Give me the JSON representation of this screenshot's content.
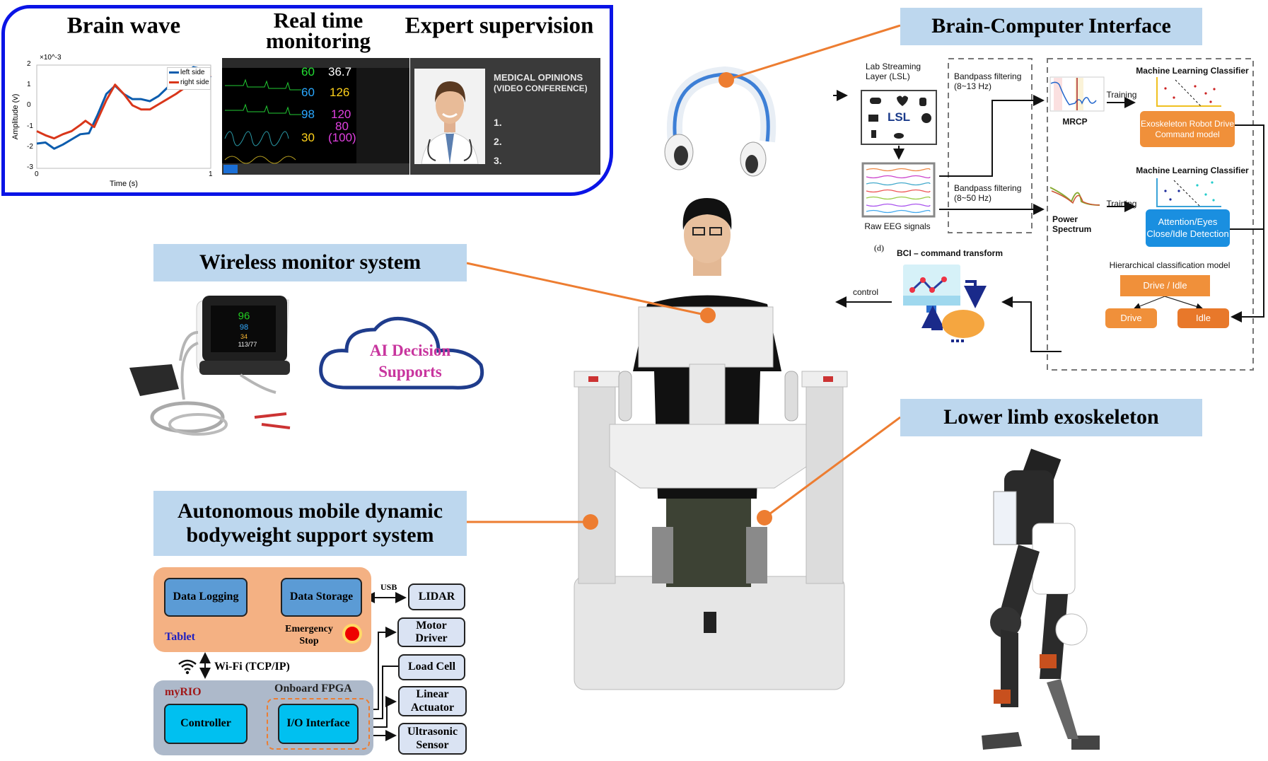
{
  "top_panel": {
    "brain_wave_title": "Brain wave",
    "monitoring_title": "Real time monitoring",
    "expert_title": "Expert supervision",
    "frame_color": "#0a14e6"
  },
  "chart_data": {
    "type": "line",
    "xlabel": "Time (s)",
    "ylabel": "Amplitude (v)",
    "y_multiplier": "×10^-3",
    "xlim": [
      0,
      1
    ],
    "ylim": [
      -3,
      2
    ],
    "x_ticks": [
      "0",
      "1"
    ],
    "y_ticks": [
      "2",
      "1",
      "0",
      "-1",
      "-2",
      "-3"
    ],
    "legend_placement": "top-right",
    "series": [
      {
        "name": "left side",
        "color": "#0b5cad",
        "x": [
          0,
          0.05,
          0.1,
          0.15,
          0.2,
          0.25,
          0.3,
          0.35,
          0.4,
          0.45,
          0.5,
          0.55,
          0.6,
          0.65,
          0.7,
          0.75,
          0.8,
          0.85,
          0.9,
          0.95,
          1.0
        ],
        "y": [
          -1.8,
          -1.75,
          -2.05,
          -1.85,
          -1.6,
          -1.35,
          -1.3,
          -0.4,
          0.6,
          1.0,
          0.6,
          0.35,
          0.35,
          0.25,
          0.5,
          0.9,
          1.3,
          1.6,
          1.9,
          1.8,
          1.4
        ]
      },
      {
        "name": "right side",
        "color": "#d9361a",
        "x": [
          0,
          0.05,
          0.1,
          0.15,
          0.2,
          0.25,
          0.28,
          0.33,
          0.4,
          0.45,
          0.5,
          0.55,
          0.6,
          0.65,
          0.7,
          0.75,
          0.8,
          0.85,
          0.9,
          0.95,
          1.0
        ],
        "y": [
          -1.2,
          -1.4,
          -1.55,
          -1.35,
          -1.2,
          -0.9,
          -0.7,
          -1.0,
          0.3,
          1.05,
          0.6,
          0.05,
          -0.15,
          -0.15,
          0.1,
          0.35,
          0.6,
          0.9,
          1.1,
          1.3,
          1.5
        ]
      }
    ]
  },
  "vital_monitor": {
    "values": [
      "60",
      "36.7",
      "60",
      "126",
      "98",
      "120",
      "80",
      "30",
      "(100)"
    ],
    "colors": [
      "#22dd33",
      "#ffffff",
      "#2aa8ff",
      "#ffd21a",
      "#2aa8ff",
      "#e040e0",
      "#e040e0",
      "#ffd21a",
      "#e040e0"
    ]
  },
  "expert_panel": {
    "heading_line1": "MEDICAL OPINIONS",
    "heading_line2": "(VIDEO CONFERENCE)",
    "items": [
      "1.",
      "2.",
      "3."
    ]
  },
  "bci": {
    "title": "Brain-Computer Interface",
    "lsl_label": "Lab Streaming Layer (LSL)",
    "lsl_logo": "LSL",
    "raw_eeg_label": "Raw EEG signals",
    "bandpass_1": "Bandpass filtering (8~13 Hz)",
    "bandpass_2": "Bandpass filtering (8~50 Hz)",
    "mrcp_label": "MRCP",
    "power_spectrum_label": "Power Spectrum",
    "training_1": "Training",
    "training_2": "Training",
    "ml_classifier_1": "Machine Learning Classifier",
    "ml_classifier_2": "Machine Learning Classifier",
    "exo_model": "Exoskeleton Robot Drive Command model",
    "attention_model": "Attention/Eyes Close/Idle Detection",
    "hierarchical_label": "Hierarchical classification model",
    "drive_idle": "Drive / Idle",
    "drive": "Drive",
    "idle": "Idle",
    "panel_letter": "(d)",
    "command_transform": "BCI – command transform",
    "control": "control",
    "colors": {
      "orange": "#f0903a",
      "blue": "#1a8fe0",
      "idle": "#e8782a"
    }
  },
  "wireless": {
    "title": "Wireless monitor system",
    "device_values": [
      "96",
      "98",
      "34",
      "113/77"
    ],
    "cloud_text_line1": "AI Decision",
    "cloud_text_line2": "Supports",
    "cloud_color": "#1f3c8c",
    "cloud_text_color": "#c8359e"
  },
  "bws": {
    "title_line1": "Autonomous mobile dynamic",
    "title_line2": "bodyweight support system",
    "tablet_label": "Tablet",
    "data_logging": "Data Logging",
    "data_storage": "Data Storage",
    "emergency_stop": "Emergency Stop",
    "usb": "USB",
    "lidar": "LIDAR",
    "wifi": "Wi-Fi (TCP/IP)",
    "myrio_label": "myRIO",
    "fpga_label": "Onboard FPGA",
    "controller": "Controller",
    "io_interface": "I/O Interface",
    "motor_driver": "Motor Driver",
    "load_cell": "Load Cell",
    "linear_actuator": "Linear Actuator",
    "ultrasonic_sensor": "Ultrasonic Sensor",
    "colors": {
      "tablet": "#f4b183",
      "myrio": "#adb9ca",
      "dark_block": "#5b9bd5",
      "cyan_block": "#00c0f0",
      "peripheral": "#dae3f3"
    }
  },
  "exoskeleton": {
    "title": "Lower limb exoskeleton"
  },
  "connector_color": "#ed7d31"
}
